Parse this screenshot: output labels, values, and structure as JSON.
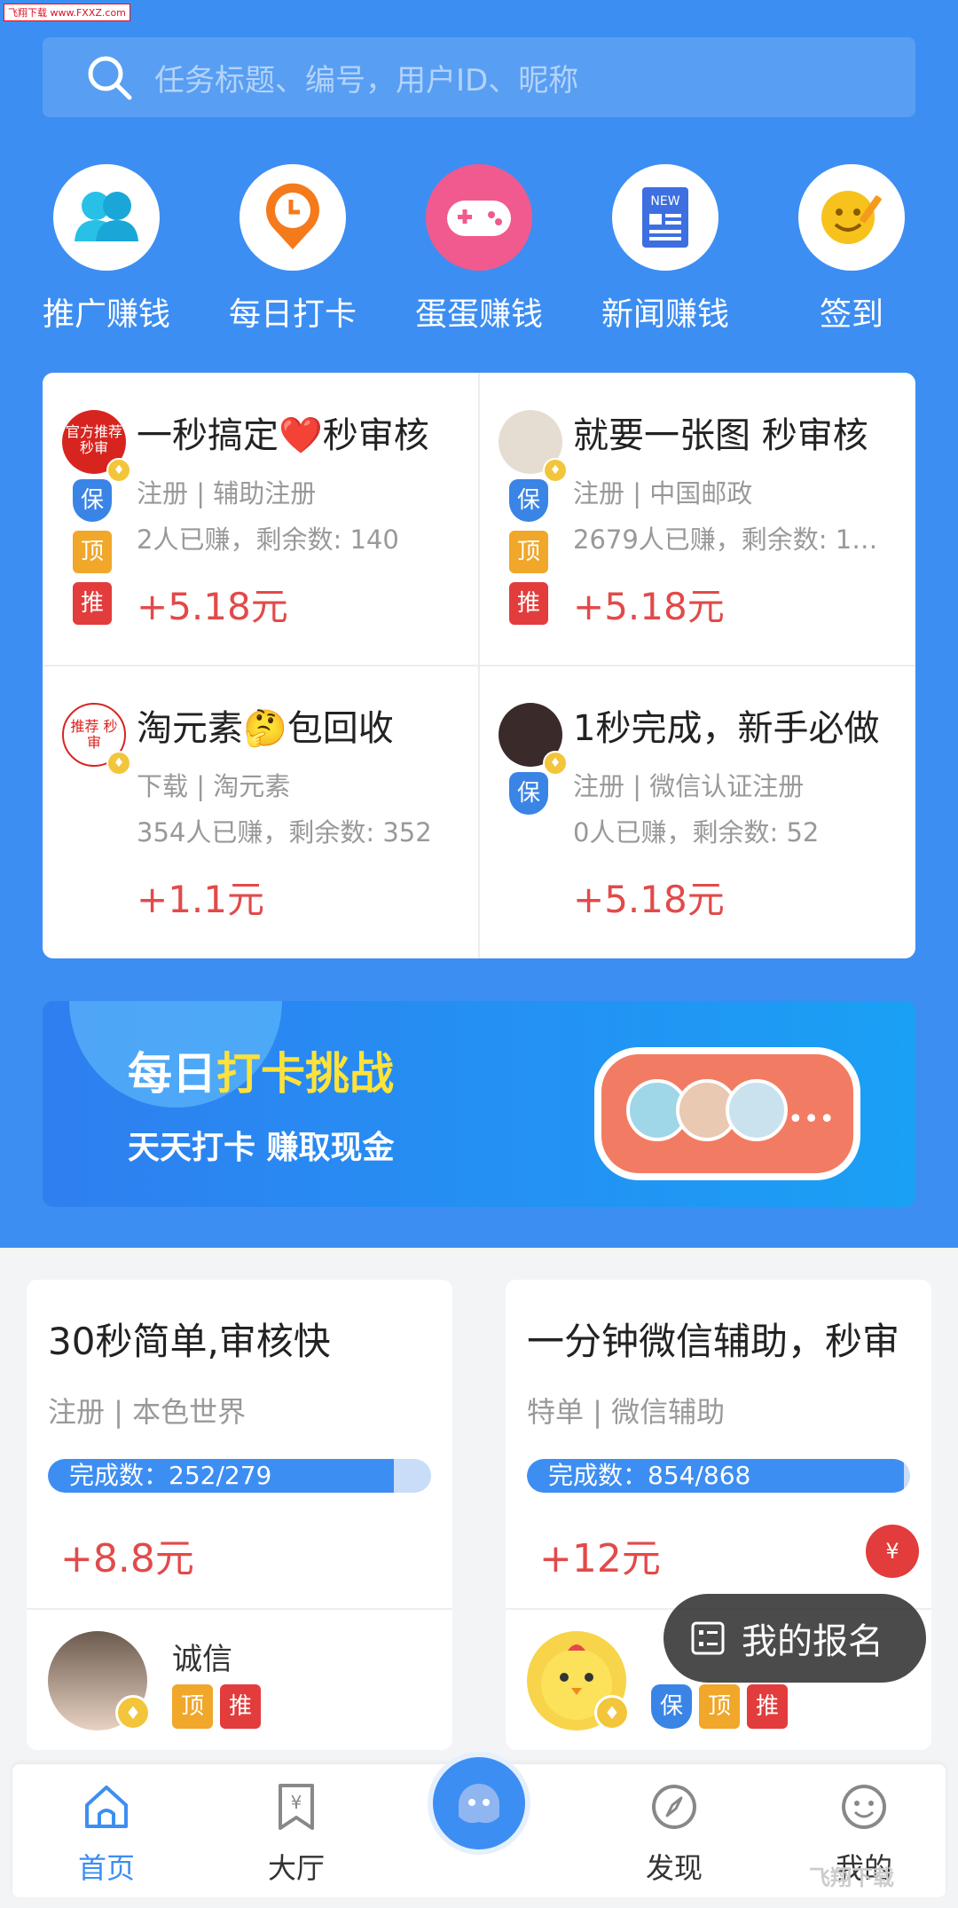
{
  "watermark_top": "飞翔下载 www.FXXZ.com",
  "search": {
    "placeholder": "任务标题、编号，用户ID、昵称"
  },
  "shortcuts": [
    {
      "label": "推广赚钱",
      "icon": "users-icon"
    },
    {
      "label": "每日打卡",
      "icon": "clock-pin-icon"
    },
    {
      "label": "蛋蛋赚钱",
      "icon": "gamepad-icon"
    },
    {
      "label": "新闻赚钱",
      "icon": "news-icon"
    },
    {
      "label": "签到",
      "icon": "smiley-pen-icon"
    }
  ],
  "tasks": [
    {
      "title": "一秒搞定❤️秒审核",
      "category": "注册 | 辅助注册",
      "stats": "2人已赚，剩余数: 140",
      "price": "+5.18元",
      "avatar_text": "官方推荐 秒审",
      "tags": [
        "保",
        "顶",
        "推"
      ]
    },
    {
      "title": "就要一张图 秒审核",
      "category": "注册 | 中国邮政",
      "stats": "2679人已赚，剩余数: 1…",
      "price": "+5.18元",
      "tags": [
        "保",
        "顶",
        "推"
      ]
    },
    {
      "title": "淘元素🤔包回收",
      "category": "下载 | 淘元素",
      "stats": "354人已赚，剩余数: 352",
      "price": "+1.1元",
      "avatar_text": "推荐 秒审",
      "tags": []
    },
    {
      "title": "1秒完成，新手必做",
      "category": "注册 | 微信认证注册",
      "stats": "0人已赚，剩余数: 52",
      "price": "+5.18元",
      "tags": [
        "保"
      ]
    }
  ],
  "banner": {
    "title_white": "每日",
    "title_yellow": "打卡挑战",
    "subtitle": "天天打卡 赚取现金",
    "dots": "•••"
  },
  "cards": [
    {
      "title": "30秒简单,审核快",
      "category": "注册 | 本色世界",
      "progress_text": "完成数：252/279",
      "progress": 0.903,
      "price": "+8.8元",
      "user": "诚信",
      "tags": [
        "顶",
        "推"
      ]
    },
    {
      "title": "一分钟微信辅助，秒审",
      "category": "特单 | 微信辅助",
      "progress_text": "完成数：854/868",
      "progress": 0.984,
      "price": "+12元",
      "user": "",
      "tags": [
        "保",
        "顶",
        "推"
      ]
    }
  ],
  "red_packet": "¥",
  "my_registration": "我的报名",
  "tabs": [
    {
      "label": "首页",
      "icon": "home-icon",
      "active": true
    },
    {
      "label": "大厅",
      "icon": "bookmark-yen-icon",
      "active": false
    },
    {
      "label": "发现",
      "icon": "compass-icon",
      "active": false
    },
    {
      "label": "我的",
      "icon": "smiley-icon",
      "active": false
    }
  ],
  "watermark_br": "飞翔下载",
  "colors": {
    "brand": "#3d8ef2",
    "price": "#e24a4a",
    "tag_bao": "#3a84e6",
    "tag_ding": "#f0a72a",
    "tag_tui": "#e23c3c"
  }
}
